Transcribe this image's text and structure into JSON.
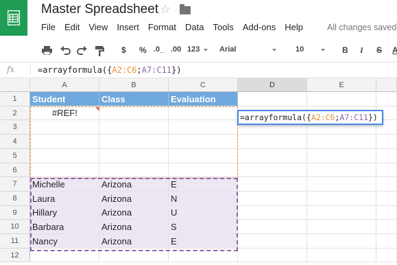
{
  "app": {
    "title": "Master Spreadsheet",
    "menu": [
      "File",
      "Edit",
      "View",
      "Insert",
      "Format",
      "Data",
      "Tools",
      "Add-ons",
      "Help"
    ],
    "save_status": "All changes saved"
  },
  "toolbar": {
    "currency": "$",
    "percent": "%",
    "decrease_decimals": ".0_",
    "increase_decimals": ".00",
    "number_format": "123",
    "font": "Arial",
    "font_size": "10",
    "bold": "B",
    "italic": "I",
    "strikethrough": "S",
    "text_color": "A"
  },
  "formula_bar": {
    "fx": "fx",
    "prefix": "=arrayformula({",
    "range1": "A2:C6",
    "sep": ";",
    "range2": "A7:C11",
    "suffix": "})"
  },
  "grid": {
    "columns": [
      "A",
      "B",
      "C",
      "D",
      "E"
    ],
    "rows": [
      "1",
      "2",
      "3",
      "4",
      "5",
      "6",
      "7",
      "8",
      "9",
      "10",
      "11",
      "12"
    ],
    "headers": [
      "Student",
      "Class",
      "Evaluation"
    ],
    "error_cell": "#REF!",
    "data": [
      [
        "Michelle",
        "Arizona",
        "E"
      ],
      [
        "Laura",
        "Arizona",
        "N"
      ],
      [
        "Hillary",
        "Arizona",
        "U"
      ],
      [
        "Barbara",
        "Arizona",
        "S"
      ],
      [
        "Nancy",
        "Arizona",
        "E"
      ]
    ]
  },
  "editor": {
    "prefix": "=arrayformula({",
    "range1": "A2:C6",
    "sep": ";",
    "range2": "A7:C11",
    "suffix": "})"
  },
  "colors": {
    "header_fill": "#6fa8dc",
    "data_fill": "#ede7f4",
    "range1": "#e69138",
    "range2": "#8e63a9",
    "editor_border": "#4a86e8",
    "brand": "#1f9d55"
  }
}
